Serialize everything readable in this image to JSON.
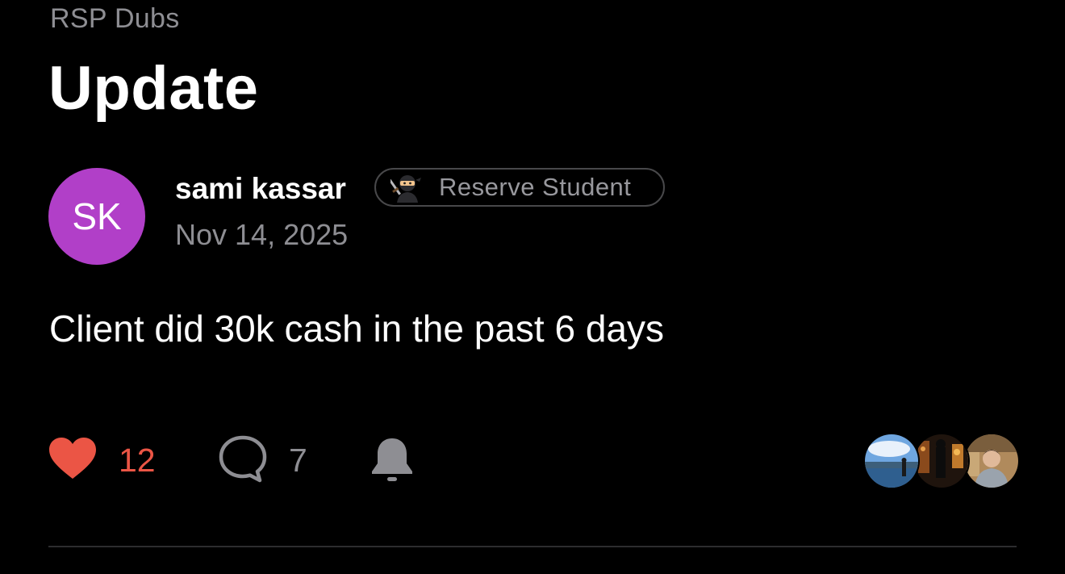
{
  "header": {
    "group_name": "RSP Dubs",
    "title": "Update"
  },
  "author": {
    "initials": "SK",
    "avatar_color": "#b13fc8",
    "name": "sami kassar",
    "badge": {
      "icon": "ninja-emoji-icon",
      "label": "Reserve Student"
    },
    "date": "Nov 14, 2025"
  },
  "post": {
    "body": "Client did 30k cash in the past 6 days"
  },
  "actions": {
    "like": {
      "icon": "heart-icon",
      "count": "12",
      "color": "#eb5545"
    },
    "comment": {
      "icon": "comment-bubble-icon",
      "count": "7"
    },
    "notify": {
      "icon": "bell-icon"
    }
  },
  "viewers": [
    {
      "icon": "viewer-avatar-landscape"
    },
    {
      "icon": "viewer-avatar-night"
    },
    {
      "icon": "viewer-avatar-person"
    }
  ]
}
